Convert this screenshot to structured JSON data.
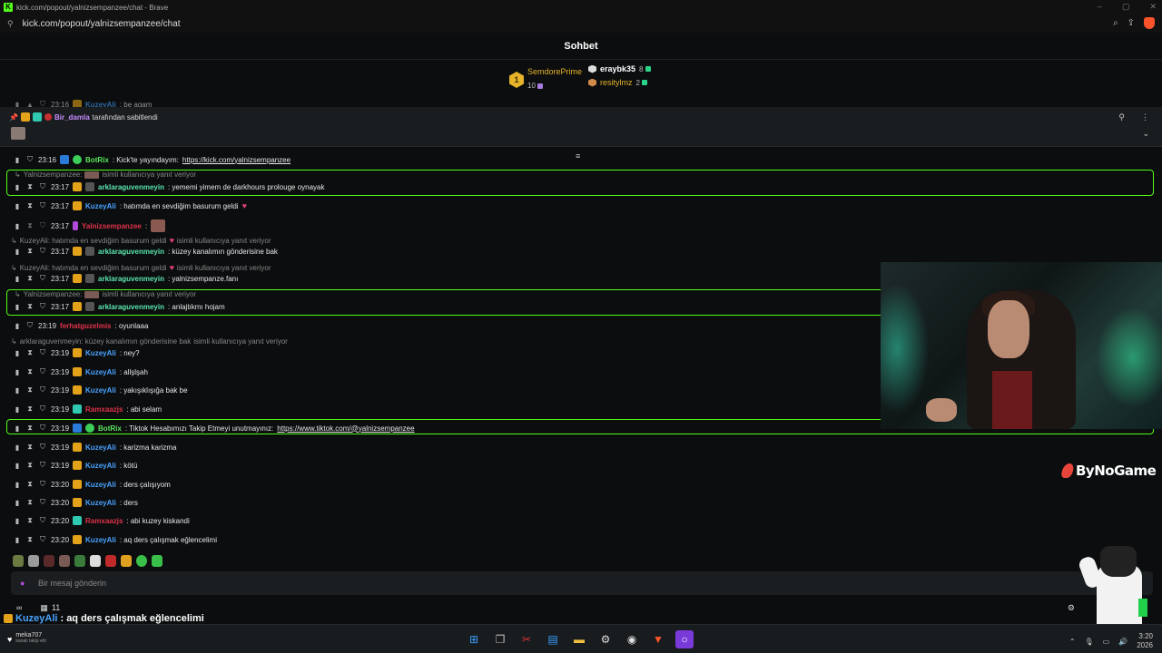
{
  "browser": {
    "title": "kick.com/popout/yalnizsempanzee/chat - Brave",
    "url": "kick.com/popout/yalnizsempanzee/chat"
  },
  "header": {
    "title": "Sohbet"
  },
  "leaderboard": {
    "first": {
      "rank": "1",
      "name": "SemdorePrime",
      "count": "10"
    },
    "second": {
      "name": "eraybk35",
      "count": "8"
    },
    "third": {
      "name": "resitylmz",
      "count": "2"
    }
  },
  "partial_top": {
    "time": "23:16",
    "user": "KuzeyAli",
    "text": ": be agam"
  },
  "pinned": {
    "user": "Bir_damla",
    "suffix": "tarafından sabitlendi"
  },
  "messages": [
    {
      "time": "23:16",
      "user": "BotRix",
      "text": ": Kick'te yayındayım: ",
      "link": "https://kick.com/yalnizsempanzee"
    },
    {
      "reply_user": "Yalnizsempanzee:",
      "reply_text": "isimli kullanıcıya yanıt veriyor",
      "time": "23:17",
      "user": "arklaraguvenmeyin",
      "text": ": yememi yimem de darkhours prolouge oynayak"
    },
    {
      "time": "23:17",
      "user": "KuzeyAli",
      "text": ": hatımda en sevdiğim basurum geldi"
    },
    {
      "time": "23:17",
      "user": "Yalnizsempanzee",
      "text": ":"
    },
    {
      "reply_user": "KuzeyAli: hatımda en sevdiğim basurum geldi",
      "reply_text": "isimli kullanıcıya yanıt veriyor",
      "time": "23:17",
      "user": "arklaraguvenmeyin",
      "text": ": küzey kanalımın gönderisine bak"
    },
    {
      "reply_user": "KuzeyAli: hatımda en sevdiğim basurum geldi",
      "reply_text": "isimli kullanıcıya yanıt veriyor",
      "time": "23:17",
      "user": "arklaraguvenmeyin",
      "text": ": yalnizsempanze.fanı"
    },
    {
      "reply_user": "Yalnizsempanzee:",
      "reply_text": "isimli kullanıcıya yanıt veriyor",
      "time": "23:17",
      "user": "arklaraguvenmeyin",
      "text": ": anlajtıkmı hojam"
    },
    {
      "time": "23:19",
      "user": "ferhatguzelmis",
      "text": ": oyunlaaa"
    },
    {
      "reply_user": "arklaraguvenmeyin: küzey kanalımın gönderisine bak",
      "reply_text": "isimli kullanıcıya yanıt veriyor",
      "time": "23:19",
      "user": "KuzeyAli",
      "text": ": ney?"
    },
    {
      "time": "23:19",
      "user": "KuzeyAli",
      "text": ": allşlşah"
    },
    {
      "time": "23:19",
      "user": "KuzeyAli",
      "text": ": yakışıklışığa bak be"
    },
    {
      "time": "23:19",
      "user": "Ramxaazjs",
      "text": ": abi selam"
    },
    {
      "time": "23:19",
      "user": "BotRix",
      "text": ": Tiktok Hesabımızı Takip Etmeyi unutmayınız: ",
      "link": "https://www.tiktok.com/@yalnizsempanzee"
    },
    {
      "time": "23:19",
      "user": "KuzeyAli",
      "text": ": karizma karizma"
    },
    {
      "time": "23:19",
      "user": "KuzeyAli",
      "text": ": kötü"
    },
    {
      "time": "23:20",
      "user": "KuzeyAli",
      "text": ": ders çalışıyom"
    },
    {
      "time": "23:20",
      "user": "KuzeyAli",
      "text": ": ders"
    },
    {
      "time": "23:20",
      "user": "Ramxaazjs",
      "text": ": abi kuzey kiskandi"
    },
    {
      "time": "23:20",
      "user": "KuzeyAli",
      "text": ": aq ders çalışmak eğlencelimi"
    }
  ],
  "input": {
    "placeholder": "Bir mesaj gönderin"
  },
  "bottom": {
    "count": "11"
  },
  "overlay": {
    "user": "KuzeyAli",
    "text": ": aq ders çalışmak eğlencelimi"
  },
  "stream_logo": {
    "text": "ByNoGame"
  },
  "taskbar": {
    "follow_user": "meka707",
    "follow_sub": "kanalı takip etti",
    "clock_time": "3:20",
    "clock_date": "2026"
  },
  "colors": {
    "kick_green": "#53fc18",
    "user_blue": "#4aa3ff",
    "user_green": "#5ce65c",
    "user_red": "#e0334a",
    "user_gold": "#e6b32a",
    "user_purple": "#c78cff",
    "user_orange": "#f0a040"
  }
}
